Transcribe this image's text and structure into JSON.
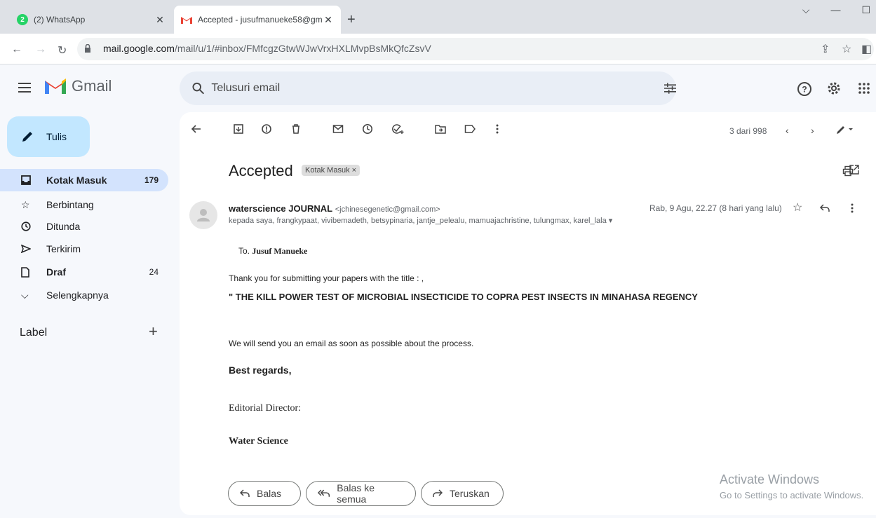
{
  "browser": {
    "tabs": [
      {
        "title": "(2) WhatsApp",
        "badge": "2"
      },
      {
        "title": "Accepted - jusufmanueke58@gm"
      }
    ],
    "url_host": "mail.google.com",
    "url_path": "/mail/u/1/#inbox/FMfcgzGtwWJwVrxHXLMvpBsMkQfcZsvV"
  },
  "gmail": {
    "logo": "Gmail",
    "search_placeholder": "Telusuri email",
    "compose": "Tulis",
    "nav": [
      {
        "label": "Kotak Masuk",
        "count": "179"
      },
      {
        "label": "Berbintang",
        "count": ""
      },
      {
        "label": "Ditunda",
        "count": ""
      },
      {
        "label": "Terkirim",
        "count": ""
      },
      {
        "label": "Draf",
        "count": "24"
      },
      {
        "label": "Selengkapnya",
        "count": ""
      }
    ],
    "labels_title": "Label"
  },
  "email": {
    "pager": "3 dari 998",
    "subject": "Accepted",
    "tag": "Kotak Masuk ×",
    "sender_name": "waterscience JOURNAL",
    "sender_email": "<jchinesegenetic@gmail.com>",
    "recipients": "kepada saya, frangkypaat, vivibemadeth, betsypinaria, jantje_pelealu, mamuajachristine, tulungmax, karel_lala ▾",
    "date": "Rab, 9 Agu, 22.27 (8 hari yang lalu)",
    "to_prefix": "To. ",
    "to_name": "Jusuf Manueke",
    "line1": "Thank you for submitting your papers with the title : ,",
    "title": "\"  THE KILL POWER TEST OF MICROBIAL INSECTICIDE TO COPRA PEST INSECTS IN MINAHASA REGENCY",
    "line2": "We will send you an email as soon as possible about the process.",
    "regards": "Best regards,",
    "director": "Editorial  Director:",
    "org": "Water Science",
    "reply": "Balas",
    "reply_all": "Balas ke semua",
    "forward": "Teruskan"
  },
  "watermark": {
    "line1": "Activate Windows",
    "line2": "Go to Settings to activate Windows."
  }
}
